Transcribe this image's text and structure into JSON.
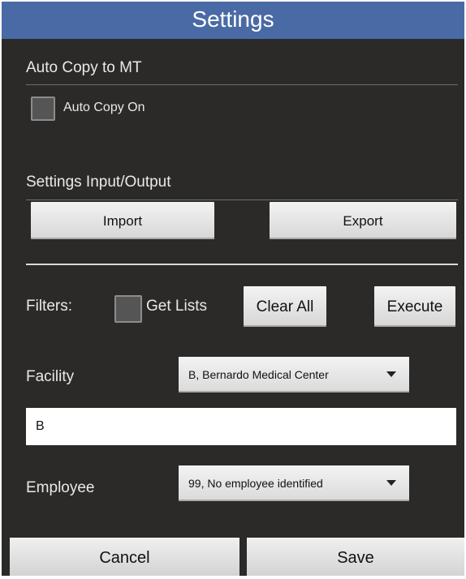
{
  "header": {
    "title": "Settings"
  },
  "auto_copy": {
    "section_title": "Auto Copy to MT",
    "checkbox_label": "Auto Copy On",
    "checked": false
  },
  "io": {
    "section_title": "Settings Input/Output",
    "import_label": "Import",
    "export_label": "Export"
  },
  "filters": {
    "label": "Filters:",
    "get_lists_label": "Get Lists",
    "get_lists_checked": false,
    "clear_all_label": "Clear All",
    "execute_label": "Execute"
  },
  "facility": {
    "label": "Facility",
    "selected": "B, Bernardo Medical Center",
    "search_value": "B"
  },
  "employee": {
    "label": "Employee",
    "selected": "99, No employee identified"
  },
  "footer": {
    "cancel_label": "Cancel",
    "save_label": "Save"
  },
  "colors": {
    "header_bg": "#4a6aa5",
    "screen_bg": "#2b2a29"
  }
}
